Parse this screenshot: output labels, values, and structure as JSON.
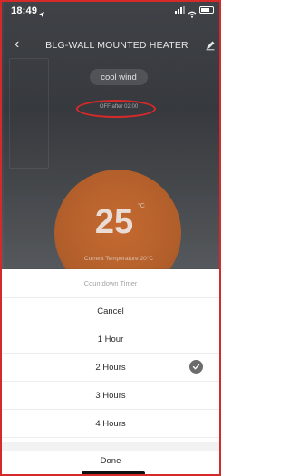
{
  "status_bar": {
    "time": "18:49",
    "location_icon": "location-arrow-icon",
    "signal_icon": "cellular-signal-icon",
    "wifi_icon": "wifi-icon",
    "battery_icon": "battery-icon"
  },
  "header": {
    "title": "BLG-WALL MOUNTED HEATER",
    "back_icon": "chevron-left-icon",
    "edit_icon": "pencil-icon"
  },
  "device": {
    "mode": "cool wind",
    "timer_status": "OFF after 02:00",
    "temperature": "25",
    "temperature_unit": "°C",
    "current_temperature": "Current Temperature 20°C"
  },
  "sheet": {
    "title": "Countdown Timer",
    "options": [
      {
        "label": "Cancel",
        "selected": false
      },
      {
        "label": "1 Hour",
        "selected": false
      },
      {
        "label": "2 Hours",
        "selected": true
      },
      {
        "label": "3 Hours",
        "selected": false
      },
      {
        "label": "4 Hours",
        "selected": false
      }
    ],
    "done_label": "Done",
    "selected_icon": "checkmark-circle-icon"
  },
  "colors": {
    "annotation_red": "#d62a2a",
    "dial_orange": "#b35f2b",
    "selected_check": "#6c6c6c"
  }
}
